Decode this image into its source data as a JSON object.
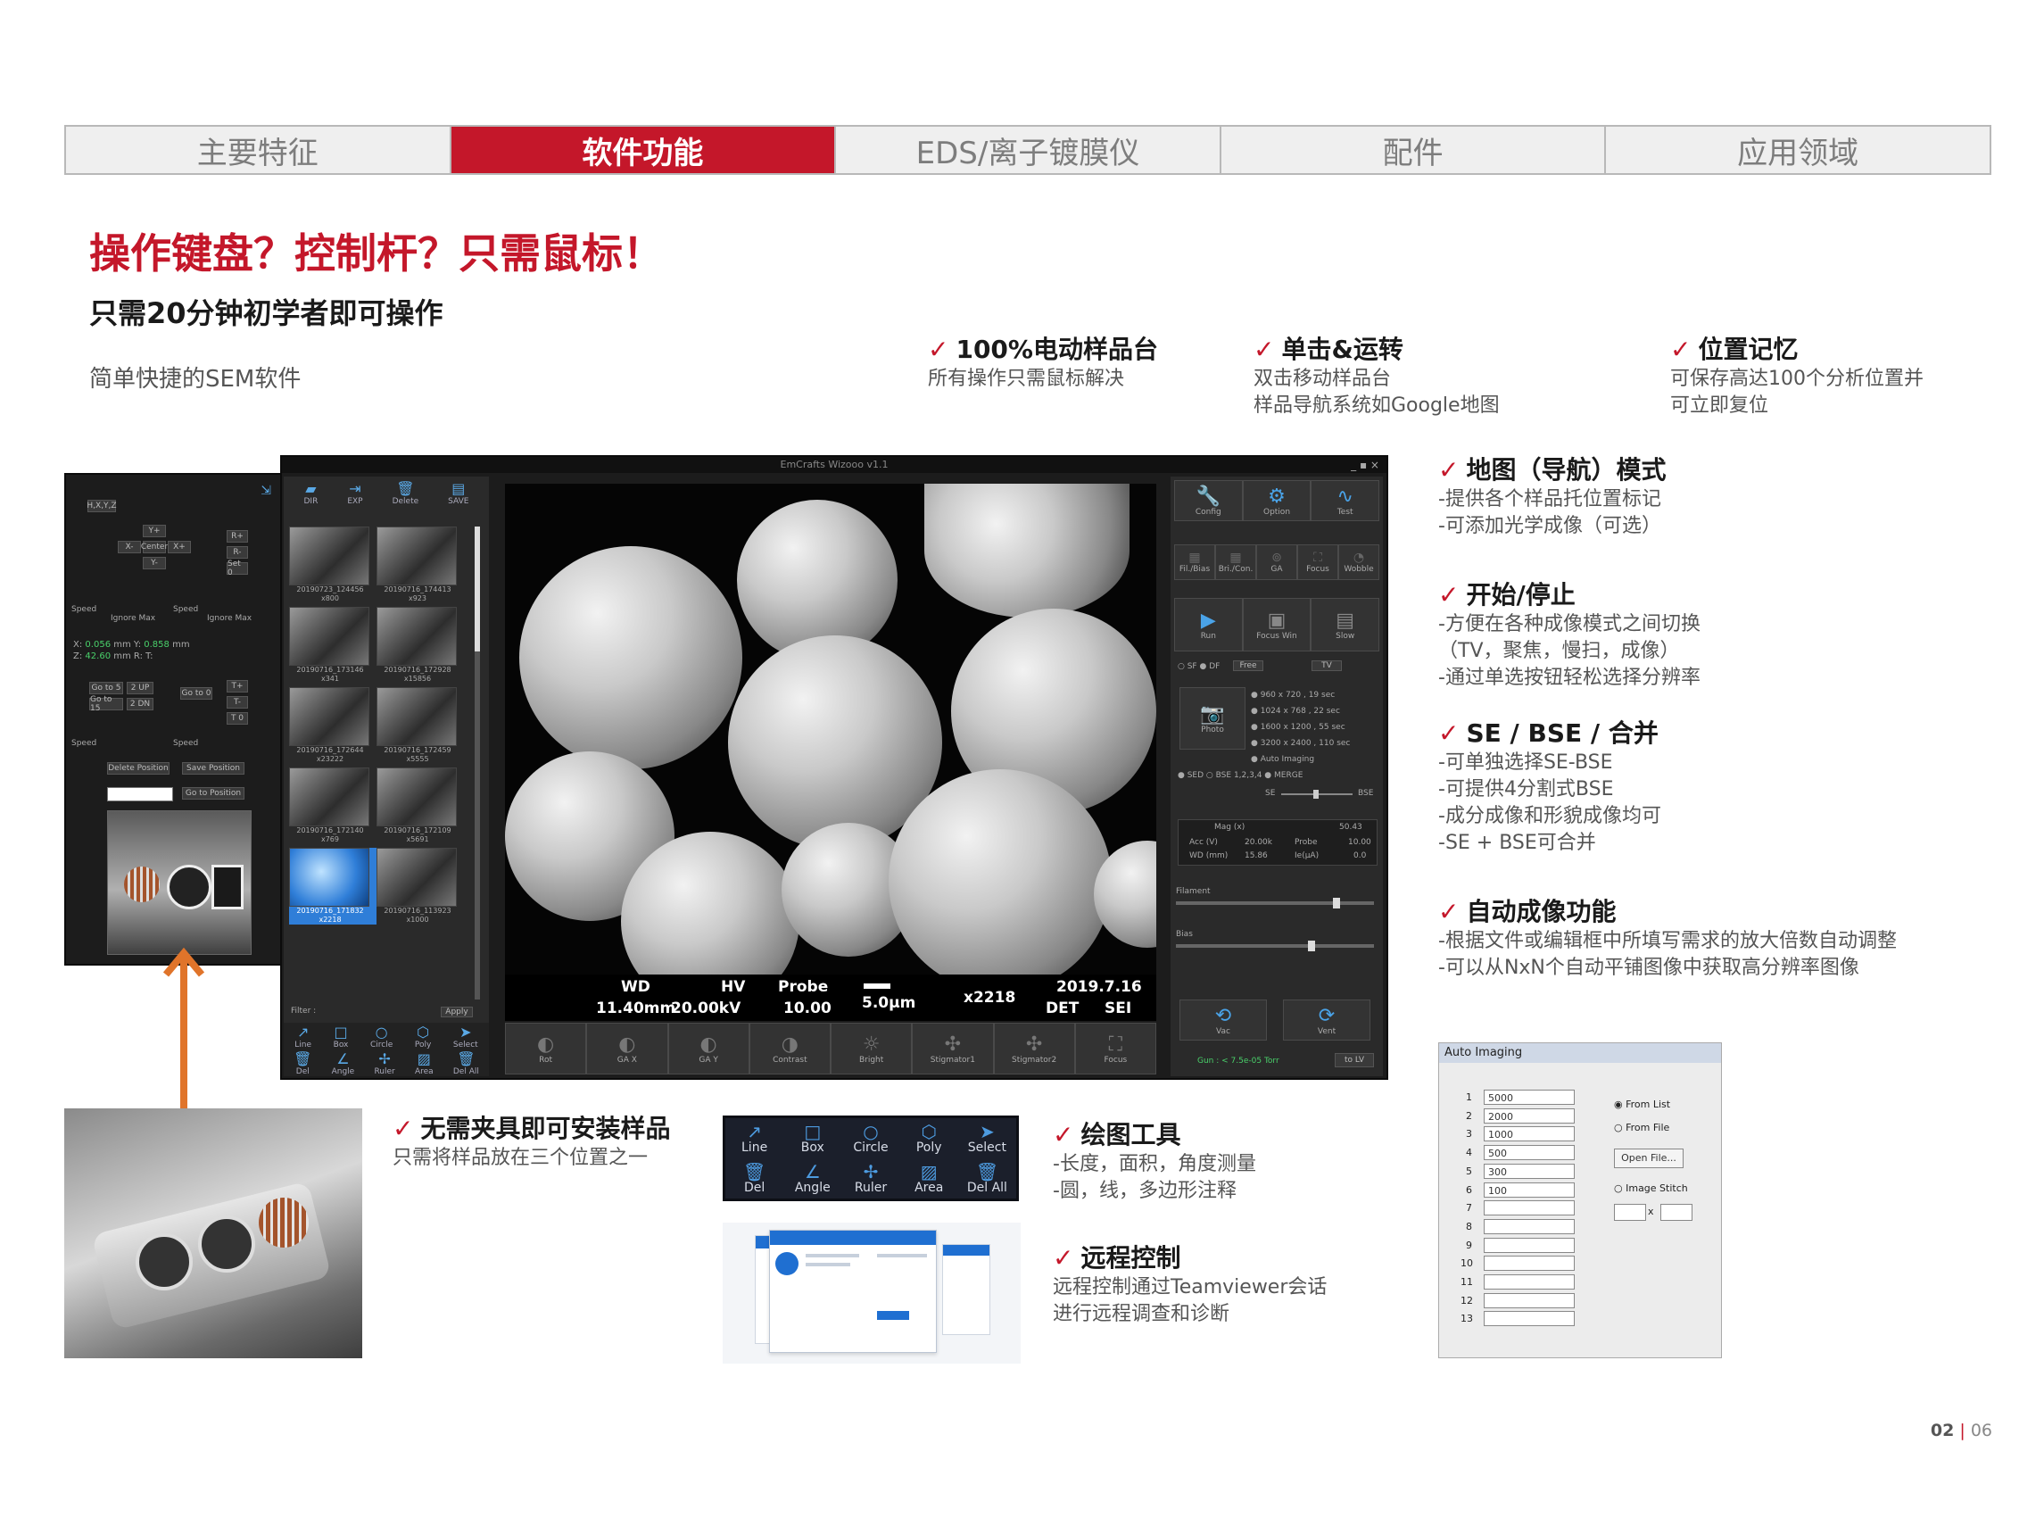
{
  "tabs": [
    "主要特征",
    "软件功能",
    "EDS/离子镀膜仪",
    "配件",
    "应用领域"
  ],
  "active_tab": 1,
  "headline": "操作键盘？控制杆？只需鼠标！",
  "subheadline": "只需20分钟初学者即可操作",
  "intro": "简单快捷的SEM软件",
  "check": "✓",
  "top_features": [
    {
      "title": "100%电动样品台",
      "lines": [
        "所有操作只需鼠标解决"
      ]
    },
    {
      "title": "单击&运转",
      "lines": [
        "双击移动样品台",
        "样品导航系统如Google地图"
      ]
    },
    {
      "title": "位置记忆",
      "lines": [
        "可保存高达100个分析位置并",
        "可立即复位"
      ]
    }
  ],
  "right_features": [
    {
      "title": "地图（导航）模式",
      "lines": [
        "-提供各个样品托位置标记",
        "-可添加光学成像（可选）"
      ]
    },
    {
      "title": "开始/停止",
      "lines": [
        "-方便在各种成像模式之间切换",
        "（TV，聚焦，慢扫，成像）",
        "-通过单选按钮轻松选择分辨率"
      ]
    },
    {
      "title": "SE / BSE / 合并",
      "lines": [
        "-可单独选择SE-BSE",
        "-可提供4分割式BSE",
        "-成分成像和形貌成像均可",
        "-SE + BSE可合并"
      ]
    },
    {
      "title": "自动成像功能",
      "lines": [
        "-根据文件或编辑框中所填写需求的放大倍数自动调整",
        "-可以从NxN个自动平铺图像中获取高分辨率图像"
      ]
    }
  ],
  "bottom_features": [
    {
      "title": "无需夹具即可安装样品",
      "lines": [
        "只需将样品放在三个位置之一"
      ]
    },
    {
      "title": "绘图工具",
      "lines": [
        "-长度，面积，角度测量",
        "-圆，线，多边形注释"
      ]
    },
    {
      "title": "远程控制",
      "lines": [
        "远程控制通过Teamviewer会话",
        "进行远程调查和诊断"
      ]
    }
  ],
  "software": {
    "title": "EmCrafts Wizooo v1.1",
    "left_panel": {
      "mode": "H,X,Y,Z",
      "arrows": {
        "up": "Y+",
        "left": "X-",
        "center": "Center",
        "right": "X+",
        "down": "Y-"
      },
      "r_buttons": [
        "R+",
        "R-",
        "Set 0"
      ],
      "speed": "Speed",
      "ignore_max": "Ignore Max",
      "coords": {
        "x_label": "X:",
        "x": "0.056",
        "y_label": "Y:",
        "y": "0.858",
        "z_label": "Z:",
        "z": "42.60",
        "r_label": "R:",
        "unit_mm": "mm",
        "t_label": "T:"
      },
      "goto": [
        "Go to 5",
        "2 UP",
        "Go to 15",
        "2 DN"
      ],
      "go_to_0": "Go to 0",
      "t_buttons": [
        "T+",
        "T-",
        "T 0"
      ],
      "delete_position": "Delete Position",
      "save_position": "Save Position",
      "go_to_position": "Go to Position"
    },
    "file_toolbar": [
      "DIR",
      "EXP",
      "Delete",
      "SAVE"
    ],
    "thumbnails": [
      {
        "name": "20190723_124456",
        "mag": "x800"
      },
      {
        "name": "20190716_174413",
        "mag": "x923"
      },
      {
        "name": "20190716_173146",
        "mag": "x341"
      },
      {
        "name": "20190716_172928",
        "mag": "x15856"
      },
      {
        "name": "20190716_172644",
        "mag": "x23222"
      },
      {
        "name": "20190716_172459",
        "mag": "x5555"
      },
      {
        "name": "20190716_172140",
        "mag": "x769"
      },
      {
        "name": "20190716_172109",
        "mag": "x5691"
      },
      {
        "name": "20190716_171832",
        "mag": "x2218"
      },
      {
        "name": "20190716_113923",
        "mag": "x1000"
      }
    ],
    "filter": "Filter :",
    "apply": "Apply",
    "draw_tools_small": [
      "Line",
      "Box",
      "Circle",
      "Poly",
      "Select",
      "Del",
      "Angle",
      "Ruler",
      "Area",
      "Del All"
    ],
    "status": {
      "wd_label": "WD",
      "wd": "11.40mm",
      "hv_label": "HV",
      "hv": "20.00kV",
      "probe_label": "Probe",
      "probe": "10.00",
      "scale": "5.0μm",
      "mag": "x2218",
      "date": "2019.7.16",
      "det_label": "DET",
      "det": "SEI"
    },
    "bottom_controls": [
      "Rot",
      "GA X",
      "GA Y",
      "Contrast",
      "Bright",
      "Stigmator1",
      "Stigmator2",
      "Focus"
    ],
    "right_top": [
      "Config",
      "Option",
      "Test"
    ],
    "right_row2": [
      "Fil./Bias",
      "Bri./Con.",
      "GA",
      "Focus",
      "Wobble"
    ],
    "right_row3": [
      "Run",
      "Focus Win",
      "Slow"
    ],
    "scan_modes": [
      "SF",
      "DF",
      "Free",
      "TV"
    ],
    "photo": "Photo",
    "resolutions": [
      "960 x 720 , 19 sec",
      "1024 x 768 , 22 sec",
      "1600 x 1200 , 55 sec",
      "3200 x 2400 , 110 sec",
      "Auto Imaging"
    ],
    "detectors": [
      "SED",
      "BSE",
      "1,2,3,4",
      "MERGE"
    ],
    "se_bse": [
      "SE",
      "BSE"
    ],
    "table": {
      "mag_label": "Mag (x)",
      "mag": "50.43",
      "acc_label": "Acc (V)",
      "acc": "20.00k",
      "probe_label": "Probe",
      "probe": "10.00",
      "wd_label": "WD (mm)",
      "wd": "15.86",
      "ie_label": "Ie(μA)",
      "ie": "0.0"
    },
    "filament": "Filament",
    "bias": "Bias",
    "vac": "Vac",
    "vent": "Vent",
    "gun": "Gun : < 7.5e-05 Torr",
    "lv": "to LV"
  },
  "draw_tools": {
    "row1": [
      {
        "icon": "↗",
        "label": "Line"
      },
      {
        "icon": "□",
        "label": "Box"
      },
      {
        "icon": "○",
        "label": "Circle"
      },
      {
        "icon": "⬡",
        "label": "Poly"
      },
      {
        "icon": "➤",
        "label": "Select"
      }
    ],
    "row2": [
      {
        "icon": "🗑",
        "label": "Del"
      },
      {
        "icon": "∠",
        "label": "Angle"
      },
      {
        "icon": "✢",
        "label": "Ruler"
      },
      {
        "icon": "▨",
        "label": "Area"
      },
      {
        "icon": "🗑",
        "label": "Del All"
      }
    ]
  },
  "auto_imaging": {
    "title": "Auto Imaging",
    "rows": [
      {
        "n": "1",
        "v": "5000"
      },
      {
        "n": "2",
        "v": "2000"
      },
      {
        "n": "3",
        "v": "1000"
      },
      {
        "n": "4",
        "v": "500"
      },
      {
        "n": "5",
        "v": "300"
      },
      {
        "n": "6",
        "v": "100"
      },
      {
        "n": "7",
        "v": ""
      },
      {
        "n": "8",
        "v": ""
      },
      {
        "n": "9",
        "v": ""
      },
      {
        "n": "10",
        "v": ""
      },
      {
        "n": "11",
        "v": ""
      },
      {
        "n": "12",
        "v": ""
      },
      {
        "n": "13",
        "v": ""
      }
    ],
    "from_list": "From List",
    "from_file": "From File",
    "open_file": "Open File...",
    "image_stitch": "Image Stitch",
    "x": "x"
  },
  "page_number": {
    "current": "02",
    "separator": "|",
    "total": "06"
  },
  "colors": {
    "accent": "#c4172a",
    "arrow": "#e0742a",
    "ui_blue": "#4aa3e8"
  }
}
